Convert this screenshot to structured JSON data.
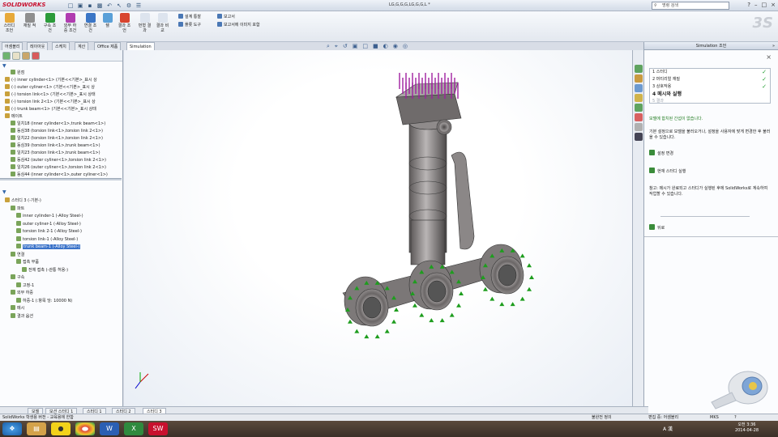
{
  "titlebar": {
    "app_name": "SOLIDWORKS",
    "document_title": "LG,G,G,G,LG,G,G,L *",
    "search_placeholder": "명령 검색",
    "help_label": "?"
  },
  "ribbon": {
    "buttons": [
      "스터디 조언",
      "재질 적",
      "구속 조건",
      "외부 하중 조건",
      "연결 조건",
      "쉘",
      "결과 조언"
    ],
    "buttons2": [
      "번형 결과",
      "결과 비교"
    ],
    "small_items": [
      "설계 통찰",
      "플롯 도구",
      "보고서",
      "보고서에 이미지 포함"
    ]
  },
  "cmd_tabs": [
    "어셈블리",
    "레이아웃",
    "스케치",
    "계산",
    "Office 제품",
    "Simulation"
  ],
  "feature_tree": [
    {
      "label": "원점",
      "indent": 1
    },
    {
      "label": "(-) inner cylinder<1> (기본<<기본>_표시 상",
      "indent": 0
    },
    {
      "label": "(-) outer cyliner<1> (기본<<기본>_표시 상",
      "indent": 0
    },
    {
      "label": "(-) torsion link<1> (기본<<기본>_표시 상태",
      "indent": 0
    },
    {
      "label": "(-) torsion link 2<1> (기본<<기본>_표시 상",
      "indent": 0
    },
    {
      "label": "(-) trunk beam<1> (기본<<기본>_표시 상태",
      "indent": 0
    },
    {
      "label": "메이트",
      "indent": 0
    },
    {
      "label": "일치18 (inner cylinder<1>,trunk beam<1>)",
      "indent": 1
    },
    {
      "label": "동심38 (torsion link<1>,torsion link 2<1>)",
      "indent": 1
    },
    {
      "label": "일치22 (torsion link<1>,torsion link 2<1>)",
      "indent": 1
    },
    {
      "label": "동심39 (torsion link<1>,trunk beam<1>)",
      "indent": 1
    },
    {
      "label": "일치23 (torsion link<1>,trunk beam<1>)",
      "indent": 1
    },
    {
      "label": "동심42 (outer cyliner<1>,torsion link 2<1>)",
      "indent": 1
    },
    {
      "label": "일치26 (outer cyliner<1>,torsion link 2<1>)",
      "indent": 1
    },
    {
      "label": "동심44 (inner cylinder<1>,outer cyliner<1>)",
      "indent": 1
    }
  ],
  "sim_tree": [
    {
      "label": "스터디 3 (-기본-)",
      "indent": 0
    },
    {
      "label": "파트",
      "indent": 1
    },
    {
      "label": "inner cylinder-1 (-Alloy Steel-)",
      "indent": 2
    },
    {
      "label": "outer cyliner-1 (-Alloy Steel-)",
      "indent": 2
    },
    {
      "label": "torsion link 2-1 (-Alloy Steel-)",
      "indent": 2
    },
    {
      "label": "torsion link-1 (-Alloy Steel-)",
      "indent": 2
    },
    {
      "label": "trunk beam-1 (-Alloy Steel-)",
      "indent": 2,
      "selected": true
    },
    {
      "label": "연결",
      "indent": 1
    },
    {
      "label": "접촉 부품",
      "indent": 2
    },
    {
      "label": "전체 접촉 (-관통 허용-)",
      "indent": 3
    },
    {
      "label": "구속",
      "indent": 1
    },
    {
      "label": "고정-1",
      "indent": 2
    },
    {
      "label": "외부 하중",
      "indent": 1
    },
    {
      "label": "하중-1 (:항목 당: 10000 N)",
      "indent": 2
    },
    {
      "label": "메시",
      "indent": 1
    },
    {
      "label": "결과 옵션",
      "indent": 1
    }
  ],
  "bottom_tabs": [
    "모델",
    "모션 스터디 1",
    "스터디 1",
    "스터디 2",
    "스터디 3"
  ],
  "right_panel": {
    "title": "Simulation 조언",
    "steps": [
      {
        "num": "1",
        "label": "스터디",
        "done": true
      },
      {
        "num": "2",
        "label": "머티리얼 재질",
        "done": true
      },
      {
        "num": "3",
        "label": "상호작용",
        "done": true
      },
      {
        "num": "4",
        "label": "메시와 실행",
        "done": false,
        "current": true
      },
      {
        "num": "5",
        "label": "결과",
        "done": false,
        "disabled": true
      }
    ],
    "status_text": "모델에 합치된 간섭이 없습니다.",
    "desc_text": "기본 설정으로 모델을 불러오거나, 설정을 사용자에 맞게 변경한 후 불러올 수 있습니다.",
    "action1": "설정 변경",
    "action2": "현재 스터디 실행",
    "note_text": "참고: 메시가 완료되고 스터디가 실행된 후에 SolidWorks로 계속하여 작업할 수 있습니다.",
    "back": "뒤로"
  },
  "statusbar": {
    "left": "SolidWorks 학생용 버전 - 교육용에 한함",
    "center": "불완전 정의",
    "edit": "편집 중: 어셈블리",
    "units": "MKS"
  },
  "taskbar": {
    "time": "오전 3:36",
    "date": "2014-04-28",
    "lang": "A 漢"
  },
  "colors": {
    "load_arrows": "#a020a0",
    "fixture_arrows": "#1e9d1e",
    "part_body": "#8e8a8a",
    "accent": "#3b73c9"
  }
}
